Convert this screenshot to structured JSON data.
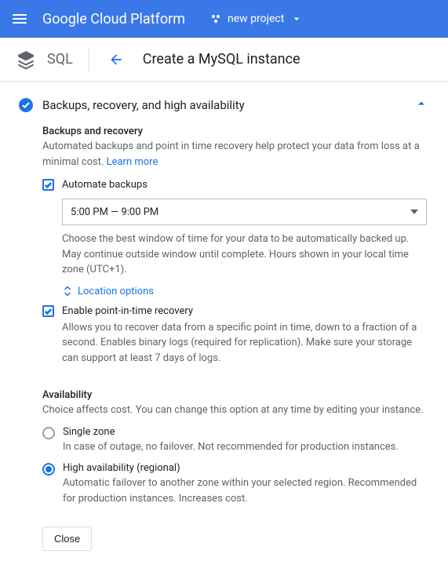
{
  "topbar": {
    "brand": "Google Cloud Platform",
    "project": "new project"
  },
  "subheader": {
    "product": "SQL",
    "page_title": "Create a MySQL instance"
  },
  "section": {
    "title": "Backups, recovery, and high availability",
    "backups": {
      "heading": "Backups and recovery",
      "helper": "Automated backups and point in time recovery help protect your data from loss at a minimal cost. ",
      "learn_more": "Learn more",
      "automate_label": "Automate backups",
      "window_value": "5:00 PM — 9:00 PM",
      "window_helper": "Choose the best window of time for your data to be automatically backed up. May continue outside window until complete. Hours shown in your local time zone (UTC+1).",
      "location_toggle": "Location options",
      "pitr_label": "Enable point-in-time recovery",
      "pitr_helper": "Allows you to recover data from a specific point in time, down to a fraction of a second. Enables binary logs (required for replication). Make sure your storage can support at least 7 days of logs."
    },
    "availability": {
      "heading": "Availability",
      "helper": "Choice affects cost. You can change this option at any time by editing your instance.",
      "single_label": "Single zone",
      "single_helper": "In case of outage, no failover. Not recommended for production instances.",
      "ha_label": "High availability (regional)",
      "ha_helper": "Automatic failover to another zone within your selected region. Recommended for production instances. Increases cost."
    },
    "close": "Close"
  }
}
